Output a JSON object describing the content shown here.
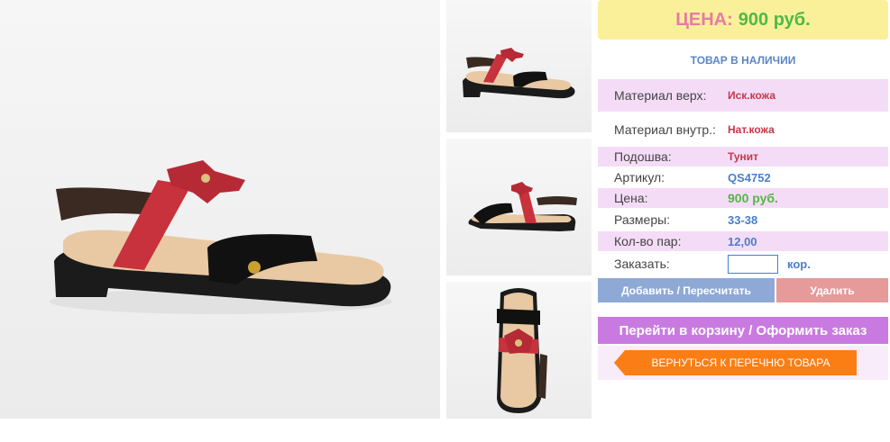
{
  "price_box": {
    "label": "ЦЕНА:",
    "value": "900 руб."
  },
  "stock_status": "ТОВАР В НАЛИЧИИ",
  "details": [
    {
      "label": "Материал верх:",
      "value": "Иск.кожа"
    },
    {
      "label": "Материал внутр.:",
      "value": "Нат.кожа"
    },
    {
      "label": "Подошва:",
      "value": "Тунит"
    },
    {
      "label": "Артикул:",
      "value": "QS4752"
    },
    {
      "label": "Цена:",
      "value": "900 руб."
    },
    {
      "label": "Размеры:",
      "value": "33-38"
    },
    {
      "label": "Кол-во пар:",
      "value": "12,00"
    }
  ],
  "order": {
    "label": "Заказать:",
    "value": "",
    "unit": "кор."
  },
  "buttons": {
    "recalc": "Добавить / Пересчитать",
    "delete": "Удалить",
    "cart": "Перейти в корзину / Оформить заказ",
    "back": "Вернуться к перечню товара"
  },
  "colors": {
    "price_label": "#e97aa7",
    "price_value": "#4db948",
    "accent_blue": "#4a7fc8",
    "row_shade": "#f4dcf7",
    "back_button": "#fb7e15"
  },
  "images": {
    "main": "sandal-side-view",
    "thumb1": "sandal-side-view-small",
    "thumb2": "sandal-other-side-view",
    "thumb3": "sandal-top-view"
  }
}
